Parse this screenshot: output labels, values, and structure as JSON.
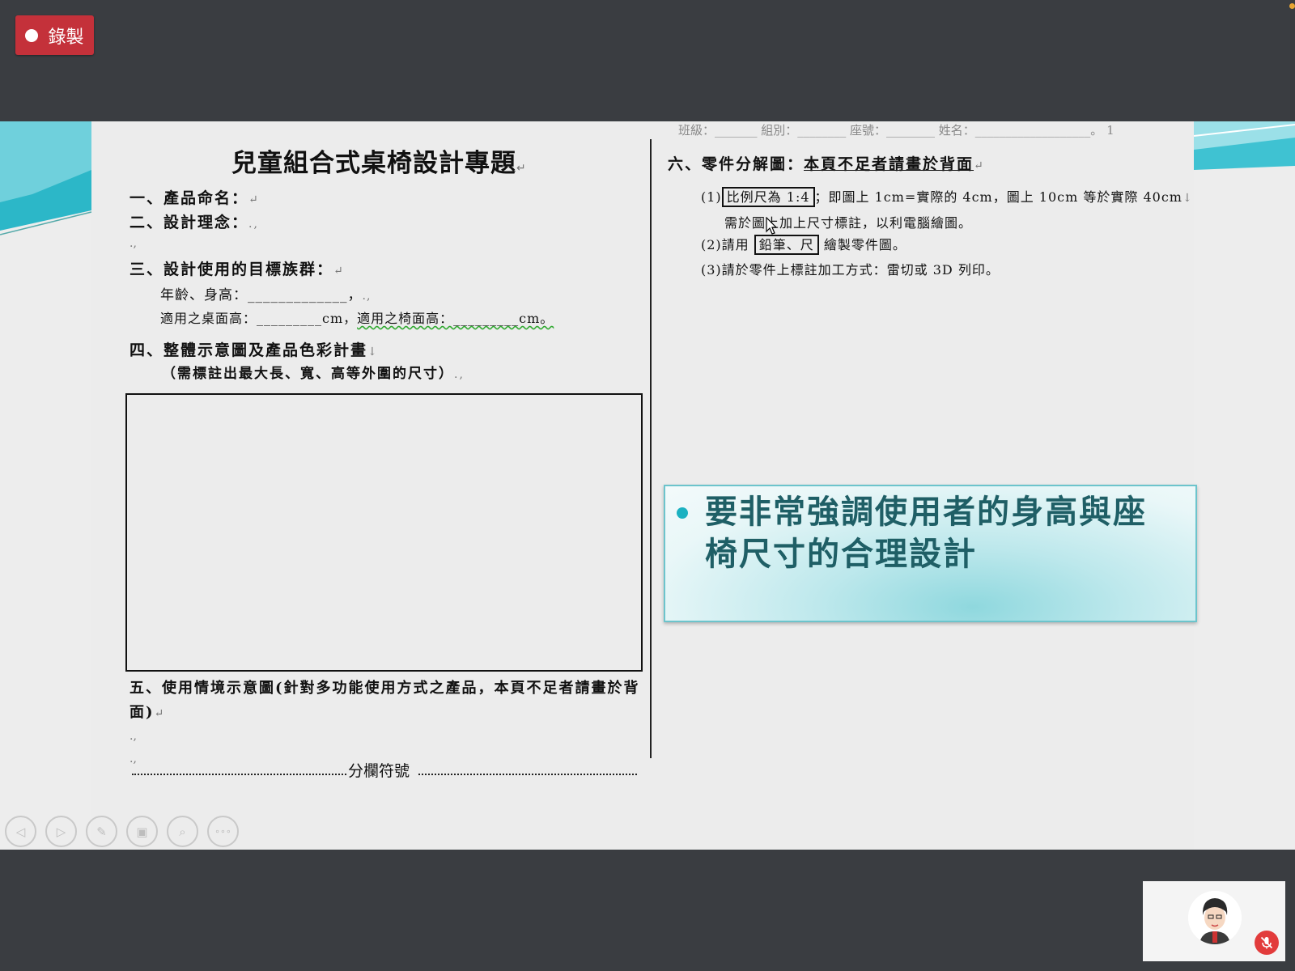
{
  "recording": {
    "label": "錄製"
  },
  "doc": {
    "header_line": "班級：_______ 組別：________ 座號：________ 姓名：___________________。 1",
    "title": "兒童組合式桌椅設計專題",
    "sec1": "一、產品命名：",
    "sec2": "二、設計理念：",
    "sec3": "三、設計使用的目標族群：",
    "sec3_age": "年齡、身高：_____________，",
    "sec3_table_label": "適用之桌面高：_________cm，",
    "sec3_chair_label": "適用之椅面高：_________cm。",
    "sec4": "四、整體示意圖及產品色彩計畫",
    "sec4_note": "（需標註出最大長、寬、高等外圍的尺寸）",
    "sec5": "五、使用情境示意圖(針對多功能使用方式之產品，本頁不足者請畫於背面)",
    "column_break": "分欄符號",
    "sec6_label": "六、零件分解圖：",
    "sec6_underlined": "本頁不足者請畫於背面",
    "item1_prefix": "(1)",
    "item1_boxed": "比例尺為 1:4",
    "item1_rest": "；即圖上 1cm=實際的 4cm，圖上 10cm 等於實際 40cm",
    "item1_line2": "需於圖上加上尺寸標註，以利電腦繪圖。",
    "item2_prefix": "(2)請用",
    "item2_boxed": "鉛筆、尺",
    "item2_rest": "繪製零件圖。",
    "item3": "(3)請於零件上標註加工方式：雷切或 3D 列印。"
  },
  "callout": {
    "text": "要非常強調使用者的身高與座椅尺寸的合理設計"
  },
  "toolbar": {
    "prev": "◁",
    "next": "▷",
    "pen": "✎",
    "slides": "▣",
    "zoom": "⌕",
    "more": "∘∘∘"
  },
  "icons": [
    "record-dot-icon",
    "prev-arrow-icon",
    "next-arrow-icon",
    "pen-icon",
    "slides-icon",
    "zoom-icon",
    "more-icon",
    "mic-off-icon",
    "user-avatar"
  ],
  "colors": {
    "record": "#c4313a",
    "accent": "#1bb1c1",
    "mic_off": "#e23b3b"
  }
}
